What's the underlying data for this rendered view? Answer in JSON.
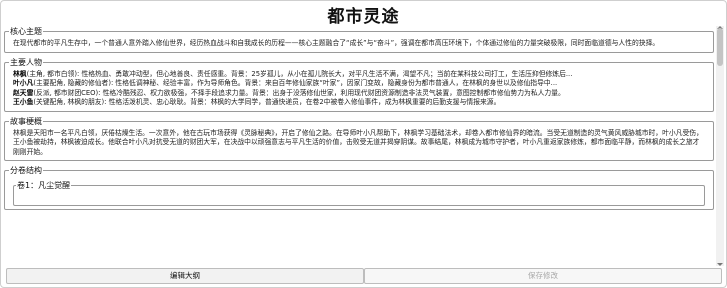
{
  "app": {
    "title": "都市灵途"
  },
  "sections": {
    "core_theme": {
      "legend": "核心主题",
      "text": "在现代都市的平凡生存中，一个普通人意外踏入修仙世界，经历热血战斗和自我成长的历程——核心主题融合了“成长”与“奋斗”，强调在都市高压环境下，个体通过修仙的力量突破极限，同时面临道德与人性的抉择。"
    },
    "characters": {
      "legend": "主要人物",
      "rows": [
        {
          "name": "林枫",
          "text": "(主角, 都市白领): 性格热血、勇敢冲动型，但心地善良、责任感重。背景：25岁孤儿，从小在孤儿院长大，对平凡生活不满，渴望不凡；当前在某科技公司打工，生活压抑但修炼后..."
        },
        {
          "name": "叶小凡",
          "text": "(主要配角, 隐藏的修仙者): 性格低调神秘、经验丰富，作为导师角色。背景：来自百年修仙家族“叶家”，因家门变故，隐藏身份为都市普通人，在林枫的身世以及修仙指导中..."
        },
        {
          "name": "赵天雷",
          "text": "(反派, 都市财团CEO): 性格冷酷残忍、权力欲极强，不择手段追求力量。背景：出身于没落修仙世家，利用现代财团资源制造非法灵气装置，意图控制都市修仙势力为私人力量。"
        },
        {
          "name": "王小鱼",
          "text": "(关键配角, 林枫的朋友): 性格活泼机灵、忠心耿耿。背景：林枫的大学同学，普通快递员，在卷2中被卷入修仙事件，成为林枫重要的后勤支援与情报来源。"
        }
      ]
    },
    "story": {
      "legend": "故事梗概",
      "text": "林枫是天阳市一名平凡白领，厌倦枯燥生活。一次意外，他在古玩市场获得《灵脉秘典》，开启了修仙之路。在导师叶小凡帮助下，林枫学习基础法术，却卷入都市修仙界的暗流。当受无道制造的灵气黄风威胁城市时，叶小凡受伤，王小鱼被劫持，林枫被迫成长。他联合叶小凡对抗受无道的财团大军，在决战中以顽强意志与平凡生活的价值，击败受无道并揭穿阴谋。故事结尾，林枫成为城市守护者，叶小凡重返家族修炼，都市面临平静，而林枫的成长之旅才刚刚开始。"
    },
    "volumes": {
      "legend": "分卷结构",
      "first_volume_legend": "卷1：凡尘觉醒"
    }
  },
  "buttons": {
    "edit": "编辑大纲",
    "save": "保存修改"
  }
}
